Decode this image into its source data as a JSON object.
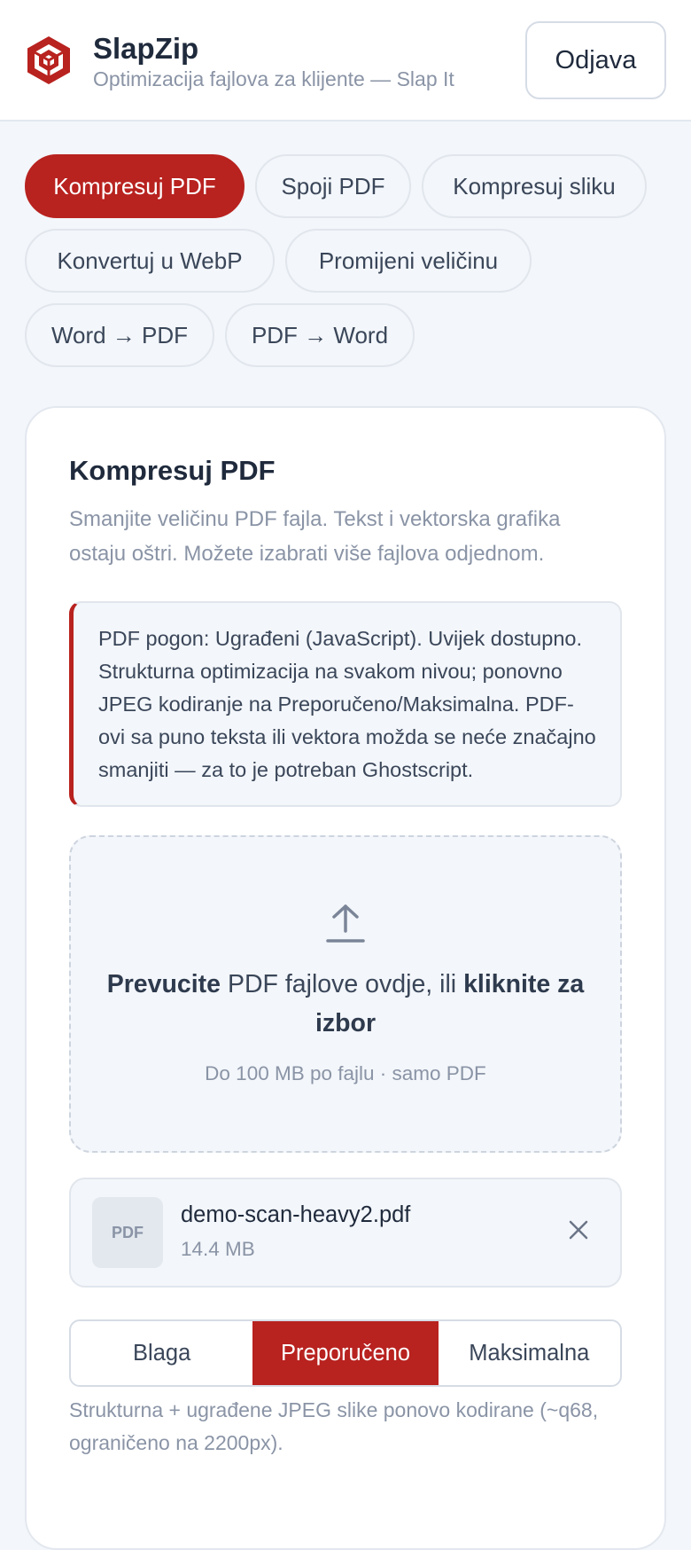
{
  "header": {
    "title": "SlapZip",
    "subtitle": "Optimizacija fajlova za klijente — Slap It",
    "logout_label": "Odjava",
    "brand_color": "#b8221f"
  },
  "tabs": [
    {
      "label": "Kompresuj PDF",
      "active": true
    },
    {
      "label": "Spoji PDF",
      "active": false
    },
    {
      "label": "Kompresuj sliku",
      "active": false
    },
    {
      "label": "Konvertuj u WebP",
      "active": false
    },
    {
      "label": "Promijeni veličinu",
      "active": false
    },
    {
      "label": "Word → PDF",
      "active": false
    },
    {
      "label": "PDF → Word",
      "active": false
    }
  ],
  "card": {
    "title": "Kompresuj PDF",
    "description": "Smanjite veličinu PDF fajla. Tekst i vektorska grafika ostaju oštri. Možete izabrati više fajlova odjednom.",
    "notice": "PDF pogon: Ugrađeni (JavaScript). Uvijek dostupno. Strukturna optimizacija na svakom nivou; ponovno JPEG kodiranje na Preporučeno/Maksimalna. PDF-ovi sa puno teksta ili vektora možda se neće značajno smanjiti — za to je potreban Ghostscript."
  },
  "dropzone": {
    "icon": "upload-icon",
    "text_strong_1": "Prevucite",
    "text_middle": " PDF fajlove ovdje, ili ",
    "text_strong_2": "kliknite za izbor",
    "hint": "Do 100 MB po fajlu · samo PDF"
  },
  "file": {
    "thumb_label": "PDF",
    "name": "demo-scan-heavy2.pdf",
    "size": "14.4 MB"
  },
  "levels": {
    "options": [
      "Blaga",
      "Preporučeno",
      "Maksimalna"
    ],
    "selected": "Preporučeno",
    "description": "Strukturna + ugrađene JPEG slike ponovo kodirane (~q68, ograničeno na 2200px)."
  }
}
